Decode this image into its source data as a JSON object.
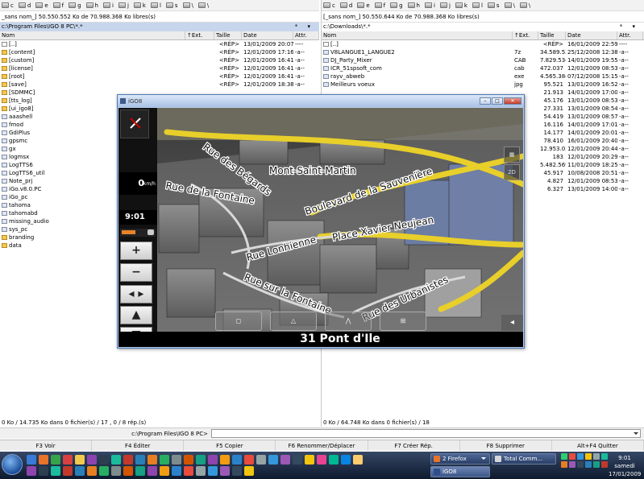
{
  "left_panel": {
    "drives": [
      "c",
      "d",
      "e",
      "f",
      "g",
      "h",
      "i",
      "j",
      "k",
      "l",
      "s",
      "\\",
      "\\"
    ],
    "free_space": "_sans nom_]  50.550.552 Ko de 70.988.368 Ko libres(s)",
    "path": "c:\\Program Files\\IGO 8 PC\\*.*",
    "path_controls": "* ▾",
    "columns": {
      "name": "Nom",
      "ext": "↑Ext.",
      "size": "Taille",
      "date": "Date",
      "attr": "Attr."
    },
    "rows": [
      {
        "name": "[..]",
        "type": "up",
        "size": "<RÉP>",
        "date": "13/01/2009 20:07",
        "attr": "----"
      },
      {
        "name": "[content]",
        "type": "dir",
        "size": "<RÉP>",
        "date": "12/01/2009 17:16",
        "attr": "-a--"
      },
      {
        "name": "[custom]",
        "type": "dir",
        "size": "<RÉP>",
        "date": "12/01/2009 16:41",
        "attr": "-a--"
      },
      {
        "name": "[license]",
        "type": "dir",
        "size": "<RÉP>",
        "date": "12/01/2009 16:41",
        "attr": "-a--"
      },
      {
        "name": "[root]",
        "type": "dir",
        "size": "<RÉP>",
        "date": "12/01/2009 16:41",
        "attr": "-a--"
      },
      {
        "name": "[save]",
        "type": "dir",
        "size": "<RÉP>",
        "date": "12/01/2009 18:38",
        "attr": "-a--"
      },
      {
        "name": "[SDMMC]",
        "type": "dir",
        "size": "",
        "date": "",
        "attr": ""
      },
      {
        "name": "[tts_log]",
        "type": "dir",
        "size": "",
        "date": "",
        "attr": ""
      },
      {
        "name": "[ui_igo8]",
        "type": "dir",
        "size": "",
        "date": "",
        "attr": ""
      },
      {
        "name": "aaashell",
        "type": "file",
        "size": "",
        "date": "",
        "attr": ""
      },
      {
        "name": "fmod",
        "type": "file",
        "size": "",
        "date": "",
        "attr": ""
      },
      {
        "name": "GdiPlus",
        "type": "file",
        "size": "",
        "date": "",
        "attr": ""
      },
      {
        "name": "gpsmc",
        "type": "file",
        "size": "",
        "date": "",
        "attr": ""
      },
      {
        "name": "gx",
        "type": "file",
        "size": "",
        "date": "",
        "attr": ""
      },
      {
        "name": "logmsx",
        "type": "file",
        "size": "",
        "date": "",
        "attr": ""
      },
      {
        "name": "LogTTS6",
        "type": "file",
        "size": "",
        "date": "",
        "attr": ""
      },
      {
        "name": "LogTTS6_util",
        "type": "file",
        "size": "",
        "date": "",
        "attr": ""
      },
      {
        "name": "Note_prj",
        "type": "file",
        "size": "",
        "date": "",
        "attr": ""
      },
      {
        "name": "iGo.v8.0.PC",
        "type": "file",
        "size": "",
        "date": "",
        "attr": ""
      },
      {
        "name": "iGo_pc",
        "type": "file",
        "size": "",
        "date": "",
        "attr": ""
      },
      {
        "name": "tahoma",
        "type": "file",
        "size": "",
        "date": "",
        "attr": ""
      },
      {
        "name": "tahomabd",
        "type": "file",
        "size": "",
        "date": "",
        "attr": ""
      },
      {
        "name": "missing_audio",
        "type": "file",
        "size": "",
        "date": "",
        "attr": ""
      },
      {
        "name": "sys_pc",
        "type": "file",
        "size": "",
        "date": "",
        "attr": ""
      },
      {
        "name": "branding",
        "type": "dir",
        "size": "",
        "date": "",
        "attr": ""
      },
      {
        "name": "data",
        "type": "dir",
        "size": "",
        "date": "",
        "attr": ""
      }
    ],
    "status": "0 Ko / 14.735 Ko dans 0 fichier(s) / 17 , 0 / 8 rép.(s)"
  },
  "right_panel": {
    "drives": [
      "c",
      "d",
      "e",
      "f",
      "g",
      "h",
      "i",
      "j",
      "k",
      "l",
      "s",
      "\\",
      "\\"
    ],
    "free_space": "[_sans nom_]  50.550.644 Ko de 70.988.368 Ko libres(s)",
    "path": "c:\\Downloads\\*.*",
    "path_controls": "* ▾",
    "columns": {
      "name": "Nom",
      "ext": "↑Ext.",
      "size": "Taille",
      "date": "Date",
      "attr": "Attr."
    },
    "rows": [
      {
        "name": "[..]",
        "type": "up",
        "ext": "",
        "size": "<RÉP>",
        "date": "16/01/2009 22:59",
        "attr": "----"
      },
      {
        "name": "V8LANGUE1_LANGUE2",
        "type": "file",
        "ext": "7z",
        "size": "34.589.527",
        "date": "25/12/2008 12:38",
        "attr": "-a--"
      },
      {
        "name": "DJ_Party_Mixer",
        "type": "file",
        "ext": "CAB",
        "size": "7.829.534",
        "date": "14/01/2009 19:55",
        "attr": "-a--"
      },
      {
        "name": "ICR_51spsoft_com",
        "type": "file",
        "ext": "cab",
        "size": "472.037",
        "date": "12/01/2009 08:53",
        "attr": "-a--"
      },
      {
        "name": "rayv_abweb",
        "type": "file",
        "ext": "exe",
        "size": "4.565.384",
        "date": "07/12/2008 15:15",
        "attr": "-a--"
      },
      {
        "name": "Meilleurs voeux",
        "type": "file",
        "ext": "jpg",
        "size": "95.521",
        "date": "13/01/2009 16:52",
        "attr": "-a--"
      },
      {
        "name": "",
        "type": "",
        "ext": "",
        "size": "21.913",
        "date": "14/01/2009 17:00",
        "attr": "-a--"
      },
      {
        "name": "",
        "type": "",
        "ext": "",
        "size": "45.176",
        "date": "13/01/2009 08:53",
        "attr": "-a--"
      },
      {
        "name": "",
        "type": "",
        "ext": "",
        "size": "27.331",
        "date": "13/01/2009 08:54",
        "attr": "-a--"
      },
      {
        "name": "",
        "type": "",
        "ext": "",
        "size": "54.419",
        "date": "13/01/2009 08:57",
        "attr": "-a--"
      },
      {
        "name": "",
        "type": "",
        "ext": "",
        "size": "16.116",
        "date": "14/01/2009 17:01",
        "attr": "-a--"
      },
      {
        "name": "",
        "type": "",
        "ext": "",
        "size": "14.177",
        "date": "14/01/2009 20:01",
        "attr": "-a--"
      },
      {
        "name": "",
        "type": "",
        "ext": "",
        "size": "78.410",
        "date": "16/01/2009 20:40",
        "attr": "-a--"
      },
      {
        "name": "",
        "type": "",
        "ext": "",
        "size": "12.953.034",
        "date": "12/01/2009 20:44",
        "attr": "-a--"
      },
      {
        "name": "",
        "type": "",
        "ext": "",
        "size": "183",
        "date": "12/01/2009 20:29",
        "attr": "-a--"
      },
      {
        "name": "",
        "type": "",
        "ext": "",
        "size": "5.482.569",
        "date": "11/01/2009 18:25",
        "attr": "-a--"
      },
      {
        "name": "",
        "type": "",
        "ext": "",
        "size": "45.917",
        "date": "10/08/2008 20:51",
        "attr": "-a--"
      },
      {
        "name": "",
        "type": "",
        "ext": "",
        "size": "4.827",
        "date": "12/01/2009 08:53",
        "attr": "-a--"
      },
      {
        "name": "",
        "type": "",
        "ext": "",
        "size": "6.327",
        "date": "13/01/2009 14:00",
        "attr": "-a--"
      }
    ],
    "status": "0 Ko / 64.748 Ko dans 0 fichier(s) / 18"
  },
  "command_line": {
    "label": "c:\\Program Files\\IGO 8 PC>",
    "value": ""
  },
  "function_keys": [
    "F3 Voir",
    "F4 Éditer",
    "F5 Copier",
    "F6 Renommer/Déplacer",
    "F7 Créer Rép.",
    "F8 Supprimer",
    "Alt+F4 Quitter"
  ],
  "igo": {
    "title": "iGO8",
    "speed": "0",
    "speed_unit": "km/h",
    "time": "9:01",
    "battery_level": 0.55,
    "zoom_in": "+",
    "zoom_out": "−",
    "pan": "◂ ▸",
    "tilt_up": "▲",
    "tilt_down": "▼",
    "right_btn_2d": "2D",
    "streets": [
      "Rue des Bégards",
      "Mont-Saint-Martin",
      "Rue de la Fontaine",
      "Boulevard de la Sauvenière",
      "Place Xavier Neujean",
      "Rue Lonhienne",
      "Rue sur la Fontaine",
      "Rue des Urbanistes"
    ],
    "current_street": "31 Pont d'Ile"
  },
  "taskbar": {
    "buttons": [
      {
        "label": "2 Firefox",
        "color": "#e8732a"
      },
      {
        "label": "Total Comm...",
        "color": "#d6d6d6"
      },
      {
        "label": "iGO8",
        "color": "#2d4e8a"
      }
    ],
    "clock_time": "9:01",
    "clock_day": "samedi",
    "clock_date": "17/01/2009"
  }
}
